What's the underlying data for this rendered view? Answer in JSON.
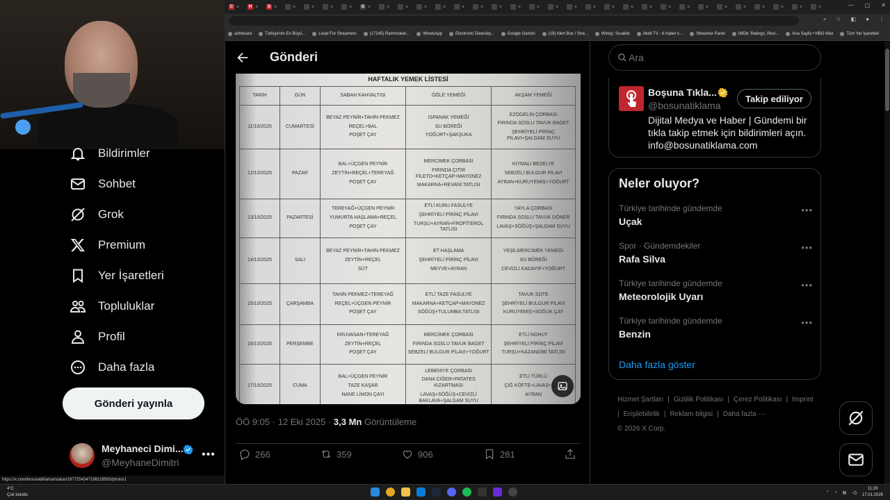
{
  "browser": {
    "tabs": [
      "C",
      "H",
      "S",
      "",
      "",
      "",
      "",
      "G",
      "",
      "",
      "",
      "",
      "",
      "",
      "",
      "",
      "",
      "",
      "",
      "",
      "",
      "",
      "",
      "",
      "",
      "",
      "",
      "",
      "",
      "",
      "",
      ""
    ],
    "bookmarks": [
      "ashboard",
      "Türkiye'nin En Büyü...",
      "Livad For Streamers",
      "(17145) Rammstein...",
      "WhatsApp",
      "Electronic Diversity...",
      "Google Gemini",
      "(19) Alert Box / Stre...",
      "Windy: Sıcaklık",
      "Multi TV - 6 haber k...",
      "Streamer Panel",
      "IMDb: Ratings, Revi...",
      "Ana Sayfa • HBO Max",
      "Tüm Yer İşaretleri"
    ]
  },
  "sidebar": {
    "items": [
      {
        "label": "Bildirimler",
        "icon": "bell-icon"
      },
      {
        "label": "Sohbet",
        "icon": "envelope-icon"
      },
      {
        "label": "Grok",
        "icon": "grok-icon"
      },
      {
        "label": "Premium",
        "icon": "x-logo-icon"
      },
      {
        "label": "Yer İşaretleri",
        "icon": "bookmark-icon"
      },
      {
        "label": "Topluluklar",
        "icon": "people-icon"
      },
      {
        "label": "Profil",
        "icon": "person-icon"
      },
      {
        "label": "Daha fazla",
        "icon": "more-circle-icon"
      }
    ],
    "post_button": "Gönderi yayınla",
    "account": {
      "name": "Meyhaneci Dimi...",
      "handle": "@MeyhaneDimitri"
    }
  },
  "status_url": "https://x.com/bosunatiklama/status/1977254347198128593/photo/1",
  "main": {
    "title": "Gönderi",
    "menu": {
      "title": "HAFTALIK YEMEK LİSTESİ",
      "headers": [
        "TARİH",
        "GÜN",
        "SABAH KAHVALTISI",
        "ÖĞLE YEMEĞİ",
        "AKŞAM YEMEĞİ"
      ],
      "rows": [
        {
          "date": "11/10/2025",
          "day": "CUMARTESİ",
          "breakfast": [
            "BEYAZ PEYNİR+TAHİN PEKMEZ",
            "REÇEL+BAL",
            "POŞET ÇAY"
          ],
          "lunch": [
            "ISPANAK YEMEĞİ",
            "SU BÖREĞİ",
            "YOĞURT+ŞAKŞUKA"
          ],
          "dinner": [
            "EZOGELİN ÇORBASI",
            "FIRINDA SOSLU TAVUK BAGET",
            "ŞEHRİYELİ PİRİNÇ PİLAVI+ŞALGAM SUYU"
          ]
        },
        {
          "date": "12/10/2025",
          "day": "PAZAR",
          "breakfast": [
            "BAL+ÜÇGEN PEYNİR",
            "ZEYTİN+REÇEL+TEREYAĞ",
            "POŞET ÇAY"
          ],
          "lunch": [
            "MERCİMEK ÇORBASI",
            "FIRINDA ÇITIR FİLETO+KETÇAP+MAYONEZ",
            "MAKARNA+REVANİ TATLISI"
          ],
          "dinner": [
            "KIYMALI BEZELYE",
            "SEBZELİ BULGUR PİLAVI",
            "AYRAN+KURUYEMİŞ+YOĞURT"
          ]
        },
        {
          "date": "13/10/2025",
          "day": "PAZARTESİ",
          "breakfast": [
            "TEREYAĞ+ÜÇGEN PEYNİR",
            "YUMURTA HAŞLAMA+REÇEL",
            "POŞET ÇAY"
          ],
          "lunch": [
            "ETLİ KURU FASULYE",
            "ŞEHRİYELİ PİRİNÇ PİLAVI",
            "TURŞU+AYRAN+FROFİTEROL TATLISI"
          ],
          "dinner": [
            "YAYLA ÇORBASI",
            "FIRINDA SOSLU TAVUK DÖNER",
            "LAVAŞ+SÖĞÜŞ+ŞALGAM SUYU"
          ]
        },
        {
          "date": "14/10/2025",
          "day": "SALI",
          "breakfast": [
            "BEYAZ PEYNİR+TAHİN PEKMEZ",
            "ZEYTİN+REÇEL",
            "SÜT"
          ],
          "lunch": [
            "ET HAŞLAMA",
            "ŞEHRİYELİ PİRİNÇ PİLAVI",
            "MEYVE+AYRAN"
          ],
          "dinner": [
            "YEŞİLMERCİMEK YEMEĞİ",
            "SU BÖREĞİ",
            "CEVİZLİ KADAYIF+YOĞURT"
          ]
        },
        {
          "date": "15/10/2025",
          "day": "ÇARŞAMBA",
          "breakfast": [
            "TAHİN PEKMEZ+TEREYAĞ",
            "REÇEL+ÜÇGEN PEYNİR",
            "POŞET ÇAY"
          ],
          "lunch": [
            "ETLİ TAZE FASULYE",
            "MAKARNA+KETÇAP+MAYONEZ",
            "SÖĞÜŞ+TULUMBA TATLISI"
          ],
          "dinner": [
            "TAVUK SOTE",
            "ŞEHRİYELİ BULGUR PİLAVI",
            "KURUYEMİŞ+SOĞUK ÇAY"
          ]
        },
        {
          "date": "16/10/2025",
          "day": "PERŞEMBE",
          "breakfast": [
            "KRUVASAN+TEREYAĞ",
            "ZEYTİN+REÇEL",
            "POŞET ÇAY"
          ],
          "lunch": [
            "MERCİMEK ÇORBASI",
            "FIRINDA SOSLU TAVUK BAGET",
            "SEBZELİ BULGUR PİLAVI+YOĞURT"
          ],
          "dinner": [
            "ETLİ NOHUT",
            "ŞEHRİYELİ PİRİNÇ PİLAVI",
            "TURŞU+KAZANDİBİ TATLISI"
          ]
        },
        {
          "date": "17/10/2025",
          "day": "CUMA",
          "breakfast": [
            "BAL+ÜÇGEN PEYNİR",
            "TAZE KAŞAR",
            "NANE LİMON ÇAYI"
          ],
          "lunch": [
            "LEBENİYE ÇORBASI",
            "DANA CİĞER+PATATES KIZARTMASI",
            "LAVAŞ+SÖĞÜŞ+CEVİZLİ BAKLAVA+ŞALGAM SUYU"
          ],
          "dinner": [
            "ETLİ TÜRLÜ",
            "ÇİĞ KÖFTE+LAVAŞ+SÖ...",
            "AYRAN"
          ]
        }
      ]
    },
    "meta": {
      "time": "ÖÖ 9:05 · 12 Eki 2025 · ",
      "views": "3,3 Mn",
      "views_label": " Görüntüleme"
    },
    "actions": {
      "reply": "266",
      "repost": "359",
      "like": "906",
      "bookmark": "281"
    }
  },
  "right": {
    "search_placeholder": "Ara",
    "ad": {
      "name": "Boşuna Tıkla...",
      "handle": "@bosunatiklama",
      "follow": "Takip ediliyor",
      "bio": "Dijital Medya ve Haber | Gündemi bir tıkla takip etmek için bildirimleri açın. info@bosunatiklama.com"
    },
    "trends_title": "Neler oluyor?",
    "trends": [
      {
        "context": "Türkiye tarihinde gündemde",
        "topic": "Uçak"
      },
      {
        "context": "Spor · Gündemdekiler",
        "topic": "Rafa Silva"
      },
      {
        "context": "Türkiye tarihinde gündemde",
        "topic": "Meteorolojik Uyarı"
      },
      {
        "context": "Türkiye tarihinde gündemde",
        "topic": "Benzin"
      }
    ],
    "show_more": "Daha fazla göster",
    "footer": [
      "Hizmet Şartları",
      "|",
      "Gizlilik Politikası",
      "|",
      "Çerez Politikası",
      "|",
      "Imprint",
      "|",
      "Erişilebilirlik",
      "|",
      "Reklam bilgisi",
      "|",
      "Daha fazla ···",
      "© 2026 X Corp."
    ]
  },
  "taskbar": {
    "weather_temp": "4°C",
    "weather_text": "Çok bulutlu",
    "time": "11:29",
    "date": "17.01.2026"
  },
  "colors": {
    "accent": "#1d9bf0",
    "verified": "#e8b829",
    "bg": "#000000",
    "muted": "#71767b"
  }
}
